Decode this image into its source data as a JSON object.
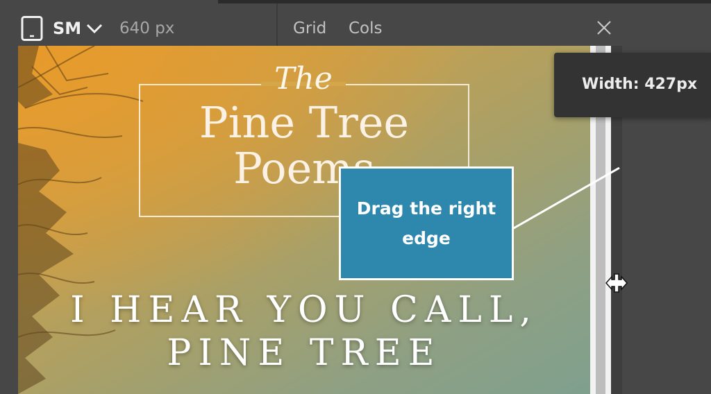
{
  "toolbar": {
    "device_icon": "tablet-icon",
    "breakpoint_label": "SM",
    "dropdown_icon": "chevron-down-icon",
    "width_value": "640 px",
    "grid_label": "Grid",
    "cols_label": "Cols",
    "close_icon": "close-icon"
  },
  "preview": {
    "title_the": "The",
    "title_line1": "Pine Tree",
    "title_line2": "Poems",
    "headline_line1": "I HEAR YOU CALL,",
    "headline_line2": "PINE TREE"
  },
  "width_tooltip": {
    "text": "Width: 427px"
  },
  "callout": {
    "text": "Drag the right edge"
  },
  "cursor": {
    "icon": "resize-horizontal-cursor-icon"
  },
  "colors": {
    "toolbar_bg": "#474747",
    "callout_bg": "#2e88ad",
    "tooltip_bg": "#333333"
  }
}
